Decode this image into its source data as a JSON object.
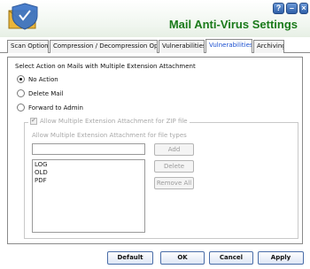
{
  "app": {
    "title": "Mail Anti-Virus Settings",
    "help_glyph": "?",
    "minimize_glyph": "–",
    "close_glyph": "×"
  },
  "tabs": [
    {
      "label": "Scan Options",
      "active": false
    },
    {
      "label": "Compression / Decompression Options",
      "active": false
    },
    {
      "label": "Vulnerabilities I",
      "active": false
    },
    {
      "label": "Vulnerabilities II",
      "active": true
    },
    {
      "label": "Archiving",
      "active": false
    }
  ],
  "panel": {
    "section_label": "Select Action on Mails with Multiple Extension Attachment",
    "options": [
      {
        "label": "No Action",
        "checked": true
      },
      {
        "label": "Delete Mail",
        "checked": false
      },
      {
        "label": "Forward to Admin",
        "checked": false
      }
    ],
    "group": {
      "checkbox_label": "Allow Multiple Extension Attachment for ZIP file",
      "checkbox_checked": true,
      "field_label": "Allow Multiple Extension Attachment for file types",
      "input_value": "",
      "list_items": [
        "LOG",
        "OLD",
        "PDF"
      ],
      "add_label": "Add",
      "delete_label": "Delete",
      "remove_all_label": "Remove All"
    }
  },
  "footer": {
    "default_label": "Default",
    "ok_label": "OK",
    "cancel_label": "Cancel",
    "apply_label": "Apply"
  }
}
